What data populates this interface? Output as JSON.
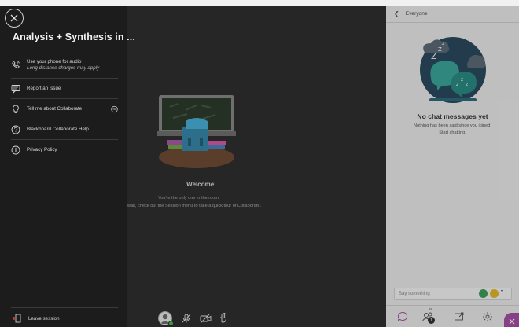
{
  "session": {
    "title": "Analysis + Synthesis in ...",
    "menu_items": [
      {
        "label": "Use your phone for audio",
        "sublabel": "Long distance charges may apply",
        "icon": "phone-icon"
      },
      {
        "label": "Report an issue",
        "icon": "report-icon"
      },
      {
        "label": "Tell me about Collaborate",
        "icon": "lightbulb-icon"
      },
      {
        "label": "Blackboard Collaborate Help",
        "icon": "help-icon"
      },
      {
        "label": "Privacy Policy",
        "icon": "info-icon"
      }
    ],
    "leave_label": "Leave session"
  },
  "stage": {
    "welcome_title": "Welcome!",
    "welcome_line1": "You're the only one in the room.",
    "welcome_line2": "wait, check out the Session menu to take a quick tour of Collaborate."
  },
  "chat": {
    "header": "Everyone",
    "empty_title": "No chat messages yet",
    "empty_line1": "Nothing has been said since you joined.",
    "empty_line2": "Start chatting.",
    "input_placeholder": "Say something",
    "attendee_count": "1",
    "attendee_label_small": "##"
  },
  "colors": {
    "accent": "#a54ea3",
    "online": "#3c9a3c"
  }
}
